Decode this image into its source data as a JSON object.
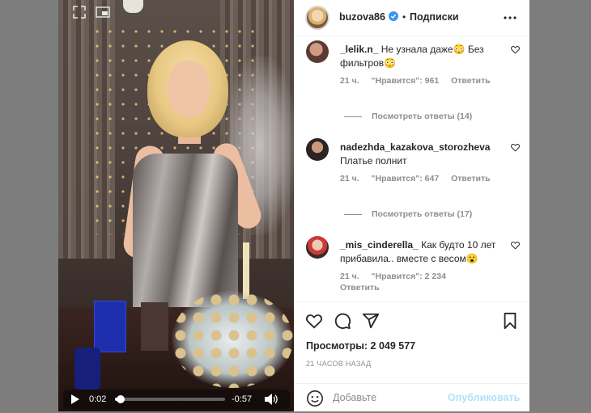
{
  "post": {
    "username": "buzova86",
    "separator": "•",
    "follow_label": "Подписки"
  },
  "video": {
    "current_time": "0:02",
    "remaining_time": "-0:57",
    "progress": 0.05
  },
  "comments": [
    {
      "username": "_lelik.n_",
      "text": "Не узнала даже😳 Без фильтров😳",
      "time": "21 ч.",
      "likes": "\"Нравится\": 961",
      "reply_label": "Ответить",
      "view_replies": "Посмотреть ответы (14)"
    },
    {
      "username": "nadezhda_kazakova_storozheva",
      "text": "Платье полнит",
      "time": "21 ч.",
      "likes": "\"Нравится\": 647",
      "reply_label": "Ответить",
      "view_replies": "Посмотреть ответы (17)"
    },
    {
      "username": "_mis_cinderella_",
      "text": "Как будто 10 лет прибавила.. вместе с весом😮",
      "time": "21 ч.",
      "likes": "\"Нравится\": 2 234",
      "reply_label": "Ответить"
    }
  ],
  "stats": {
    "views": "Просмотры: 2 049 577",
    "posted_ago": "21 ЧАСОВ НАЗАД"
  },
  "add_comment": {
    "placeholder": "Добавьте",
    "publish_label": "Опубликовать"
  },
  "colors": {
    "link_disabled": "#b2dffc",
    "meta_gray": "#8e8e8e",
    "verified_blue": "#3897f0"
  }
}
